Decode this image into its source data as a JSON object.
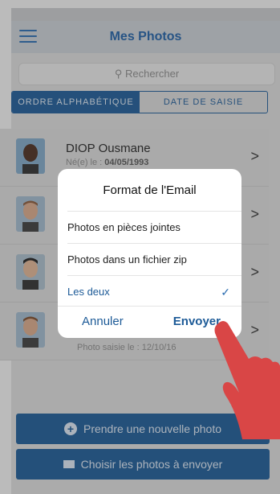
{
  "nav": {
    "title": "Mes Photos",
    "menu_icon": "hamburger-icon"
  },
  "search": {
    "placeholder": "Rechercher"
  },
  "tabs": [
    {
      "label": "ORDRE ALPHABÉTIQUE",
      "active": true
    },
    {
      "label": "DATE DE SAISIE",
      "active": false
    }
  ],
  "list": [
    {
      "name": "DIOP Ousmane",
      "sub_prefix": "Né(e) le : ",
      "sub_value": "04/05/1993"
    }
  ],
  "footnote": "Photo saisie le : 12/10/16",
  "modal": {
    "title": "Format de l'Email",
    "options": [
      {
        "label": "Photos en pièces jointes",
        "selected": false
      },
      {
        "label": "Photos dans un fichier zip",
        "selected": false
      },
      {
        "label": "Les deux",
        "selected": true
      }
    ],
    "cancel": "Annuler",
    "send": "Envoyer"
  },
  "buttons": {
    "new_photo": "Prendre une nouvelle photo",
    "choose_photos": "Choisir les photos à envoyer"
  },
  "colors": {
    "accent": "#1c5a97",
    "title_blue": "#1f5fa5",
    "hand": "#d94646"
  }
}
